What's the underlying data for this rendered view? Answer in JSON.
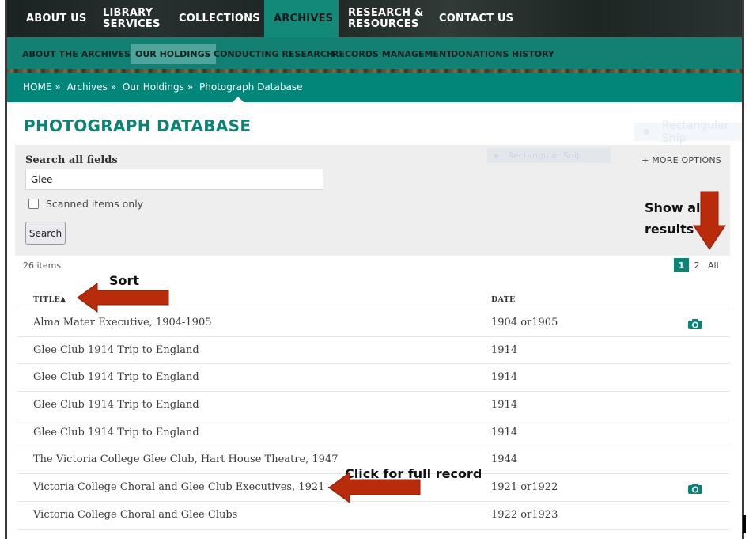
{
  "topnav": {
    "items": [
      {
        "label": "ABOUT US"
      },
      {
        "line1": "LIBRARY",
        "line2": "SERVICES"
      },
      {
        "label": "COLLECTIONS"
      },
      {
        "label": "ARCHIVES",
        "active": true
      },
      {
        "line1": "RESEARCH &",
        "line2": "RESOURCES"
      },
      {
        "label": "CONTACT US"
      }
    ]
  },
  "subnav": {
    "items": [
      {
        "label": "ABOUT THE ARCHIVES"
      },
      {
        "label": "OUR HOLDINGS",
        "active": true
      },
      {
        "label": "CONDUCTING RESEARCH"
      },
      {
        "label": "RECORDS MANAGEMENT"
      },
      {
        "label": "DONATIONS"
      },
      {
        "label": "HISTORY"
      }
    ]
  },
  "breadcrumb": {
    "items": [
      "HOME",
      "Archives",
      "Our Holdings",
      "Photograph Database"
    ],
    "separator": "»"
  },
  "page_title": "PHOTOGRAPH DATABASE",
  "search": {
    "label": "Search all fields",
    "value": "Glee",
    "scanned_only_label": "Scanned items only",
    "scanned_only_checked": false,
    "button_label": "Search",
    "more_options_label": "+ MORE OPTIONS"
  },
  "ghost_overlays": {
    "snip_label": "Rectangular Snip"
  },
  "results": {
    "count_label": "26 items",
    "pagination": {
      "pages": [
        "1",
        "2"
      ],
      "current": "1",
      "all_label": "All"
    },
    "columns": {
      "title": "TITLE▲",
      "date": "DATE"
    },
    "rows": [
      {
        "title": "Alma Mater Executive, 1904-1905",
        "date": "1904 or1905",
        "has_scan": true
      },
      {
        "title": "Glee Club 1914 Trip to England",
        "date": "1914",
        "has_scan": false
      },
      {
        "title": "Glee Club 1914 Trip to England",
        "date": "1914",
        "has_scan": false
      },
      {
        "title": "Glee Club 1914 Trip to England",
        "date": "1914",
        "has_scan": false
      },
      {
        "title": "Glee Club 1914 Trip to England",
        "date": "1914",
        "has_scan": false
      },
      {
        "title": "The Victoria College Glee Club, Hart House Theatre, 1947",
        "date": "1944",
        "has_scan": false
      },
      {
        "title": "Victoria College Choral and Glee Club Executives, 1921 - 1922",
        "date": "1921 or1922",
        "has_scan": true
      },
      {
        "title": "Victoria College Choral and Glee Clubs",
        "date": "1922 or1923",
        "has_scan": false
      }
    ]
  },
  "annotations": {
    "show_all_line1": "Show all",
    "show_all_line2": "results",
    "sort": "Sort",
    "click_record": "Click for full record",
    "arrow_color": "#b82c0c"
  },
  "colors": {
    "brand_teal": "#03867a",
    "title_teal": "#0b8475",
    "camera_teal": "#0c8375"
  }
}
